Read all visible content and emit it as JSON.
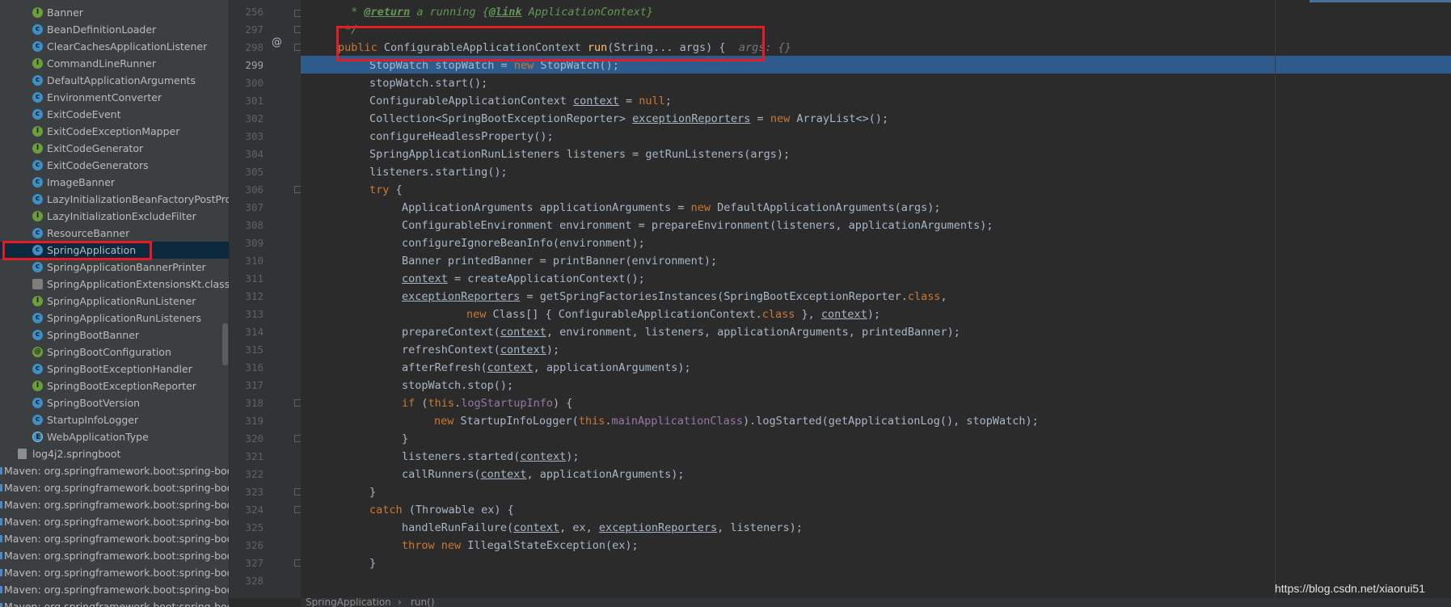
{
  "project_tree": {
    "items": [
      {
        "label": "Banner",
        "icon": "interface-icon"
      },
      {
        "label": "BeanDefinitionLoader",
        "icon": "class-icon"
      },
      {
        "label": "ClearCachesApplicationListener",
        "icon": "class-icon"
      },
      {
        "label": "CommandLineRunner",
        "icon": "interface-icon"
      },
      {
        "label": "DefaultApplicationArguments",
        "icon": "class-icon"
      },
      {
        "label": "EnvironmentConverter",
        "icon": "class-icon"
      },
      {
        "label": "ExitCodeEvent",
        "icon": "class-icon"
      },
      {
        "label": "ExitCodeExceptionMapper",
        "icon": "interface-icon"
      },
      {
        "label": "ExitCodeGenerator",
        "icon": "interface-icon"
      },
      {
        "label": "ExitCodeGenerators",
        "icon": "class-icon"
      },
      {
        "label": "ImageBanner",
        "icon": "class-icon"
      },
      {
        "label": "LazyInitializationBeanFactoryPostProces",
        "icon": "class-icon"
      },
      {
        "label": "LazyInitializationExcludeFilter",
        "icon": "interface-icon"
      },
      {
        "label": "ResourceBanner",
        "icon": "class-icon"
      },
      {
        "label": "SpringApplication",
        "icon": "class-icon"
      },
      {
        "label": "SpringApplicationBannerPrinter",
        "icon": "class-icon"
      },
      {
        "label": "SpringApplicationExtensionsKt.class",
        "icon": "kotlin-class-icon"
      },
      {
        "label": "SpringApplicationRunListener",
        "icon": "interface-icon"
      },
      {
        "label": "SpringApplicationRunListeners",
        "icon": "class-icon"
      },
      {
        "label": "SpringBootBanner",
        "icon": "class-icon"
      },
      {
        "label": "SpringBootConfiguration",
        "icon": "annotation-icon"
      },
      {
        "label": "SpringBootExceptionHandler",
        "icon": "class-icon"
      },
      {
        "label": "SpringBootExceptionReporter",
        "icon": "interface-icon"
      },
      {
        "label": "SpringBootVersion",
        "icon": "class-icon"
      },
      {
        "label": "StartupInfoLogger",
        "icon": "class-icon"
      },
      {
        "label": "WebApplicationType",
        "icon": "enum-icon"
      },
      {
        "label": "log4j2.springboot",
        "icon": "file-icon"
      }
    ],
    "selected_label": "SpringApplication",
    "maven_items": [
      "Maven: org.springframework.boot:spring-boot-",
      "Maven: org.springframework.boot:spring-boot-",
      "Maven: org.springframework.boot:spring-boot-",
      "Maven: org.springframework.boot:spring-boot-",
      "Maven: org.springframework.boot:spring-boot-",
      "Maven: org.springframework.boot:spring-boot-",
      "Maven: org.springframework.boot:spring-boot-",
      "Maven: org.springframework.boot:spring-boot-",
      "Maven: org.springframework.boot:spring-boot-"
    ]
  },
  "editor": {
    "line_numbers": [
      "256",
      "297",
      "298",
      "299",
      "300",
      "301",
      "302",
      "303",
      "304",
      "305",
      "306",
      "307",
      "308",
      "309",
      "310",
      "311",
      "312",
      "313",
      "314",
      "315",
      "316",
      "317",
      "318",
      "319",
      "320",
      "321",
      "322",
      "323",
      "324",
      "325",
      "326",
      "327",
      "328"
    ],
    "current_line": "299",
    "override_marker": "@",
    "code": {
      "l256_a": " * ",
      "l256_tag": "@return",
      "l256_b": " a running {",
      "l256_link": "@link",
      "l256_c": " ApplicationContext}",
      "l297": " */",
      "l298_kw": "public ",
      "l298_type": "ConfigurableApplicationContext ",
      "l298_fn": "run",
      "l298_rest": "(String... args) {  ",
      "l298_hint": "args: {}",
      "l299": "StopWatch stopWatch = ",
      "l299_kw": "new ",
      "l299_rest": "StopWatch();",
      "l300": "stopWatch.start();",
      "l301_a": "ConfigurableApplicationContext ",
      "l301_var": "context",
      "l301_b": " = ",
      "l301_kw": "null",
      "l301_c": ";",
      "l302_a": "Collection<SpringBootExceptionReporter> ",
      "l302_var": "exceptionReporters",
      "l302_b": " = ",
      "l302_kw": "new ",
      "l302_c": "ArrayList<>();",
      "l303": "configureHeadlessProperty();",
      "l304": "SpringApplicationRunListeners listeners = getRunListeners(args);",
      "l305": "listeners.starting();",
      "l306_kw": "try",
      "l306_b": " {",
      "l307_a": "ApplicationArguments applicationArguments = ",
      "l307_kw": "new ",
      "l307_b": "DefaultApplicationArguments(args);",
      "l308": "ConfigurableEnvironment environment = prepareEnvironment(listeners, applicationArguments);",
      "l309": "configureIgnoreBeanInfo(environment);",
      "l310": "Banner printedBanner = printBanner(environment);",
      "l311_var": "context",
      "l311_b": " = createApplicationContext();",
      "l312_var": "exceptionReporters",
      "l312_b": " = getSpringFactoriesInstances(SpringBootExceptionReporter.",
      "l312_kw": "class",
      "l312_c": ",",
      "l313_kw": "new ",
      "l313_b": "Class[] { ConfigurableApplicationContext.",
      "l313_kw2": "class",
      "l313_c": " }, ",
      "l313_var": "context",
      "l313_d": ");",
      "l314_a": "prepareContext(",
      "l314_var": "context",
      "l314_b": ", environment, listeners, applicationArguments, printedBanner);",
      "l315_a": "refreshContext(",
      "l315_var": "context",
      "l315_b": ");",
      "l316_a": "afterRefresh(",
      "l316_var": "context",
      "l316_b": ", applicationArguments);",
      "l317": "stopWatch.stop();",
      "l318_kw": "if ",
      "l318_b": "(",
      "l318_kw2": "this",
      "l318_c": ".",
      "l318_fld": "logStartupInfo",
      "l318_d": ") {",
      "l319_kw": "new ",
      "l319_b": "StartupInfoLogger(",
      "l319_kw2": "this",
      "l319_c": ".",
      "l319_fld": "mainApplicationClass",
      "l319_d": ").logStarted(getApplicationLog(), stopWatch);",
      "l320": "}",
      "l321_a": "listeners.started(",
      "l321_var": "context",
      "l321_b": ");",
      "l322_a": "callRunners(",
      "l322_var": "context",
      "l322_b": ", applicationArguments);",
      "l323": "}",
      "l324_kw": "catch",
      "l324_b": " (Throwable ex) {",
      "l325_a": "handleRunFailure(",
      "l325_var": "context",
      "l325_b": ", ex, ",
      "l325_var2": "exceptionReporters",
      "l325_c": ", listeners);",
      "l326_kw": "throw ",
      "l326_kw2": "new ",
      "l326_b": "IllegalStateException(ex);",
      "l327": "}",
      "l328": ""
    }
  },
  "breadcrumb": {
    "class_name": "SpringApplication",
    "sep": "›",
    "method": "run()"
  },
  "watermark": "https://blog.csdn.net/xiaorui51",
  "colors": {
    "highlight": "#2d5c8c",
    "red_box": "#e51c23",
    "selected_row": "#0d293e"
  }
}
